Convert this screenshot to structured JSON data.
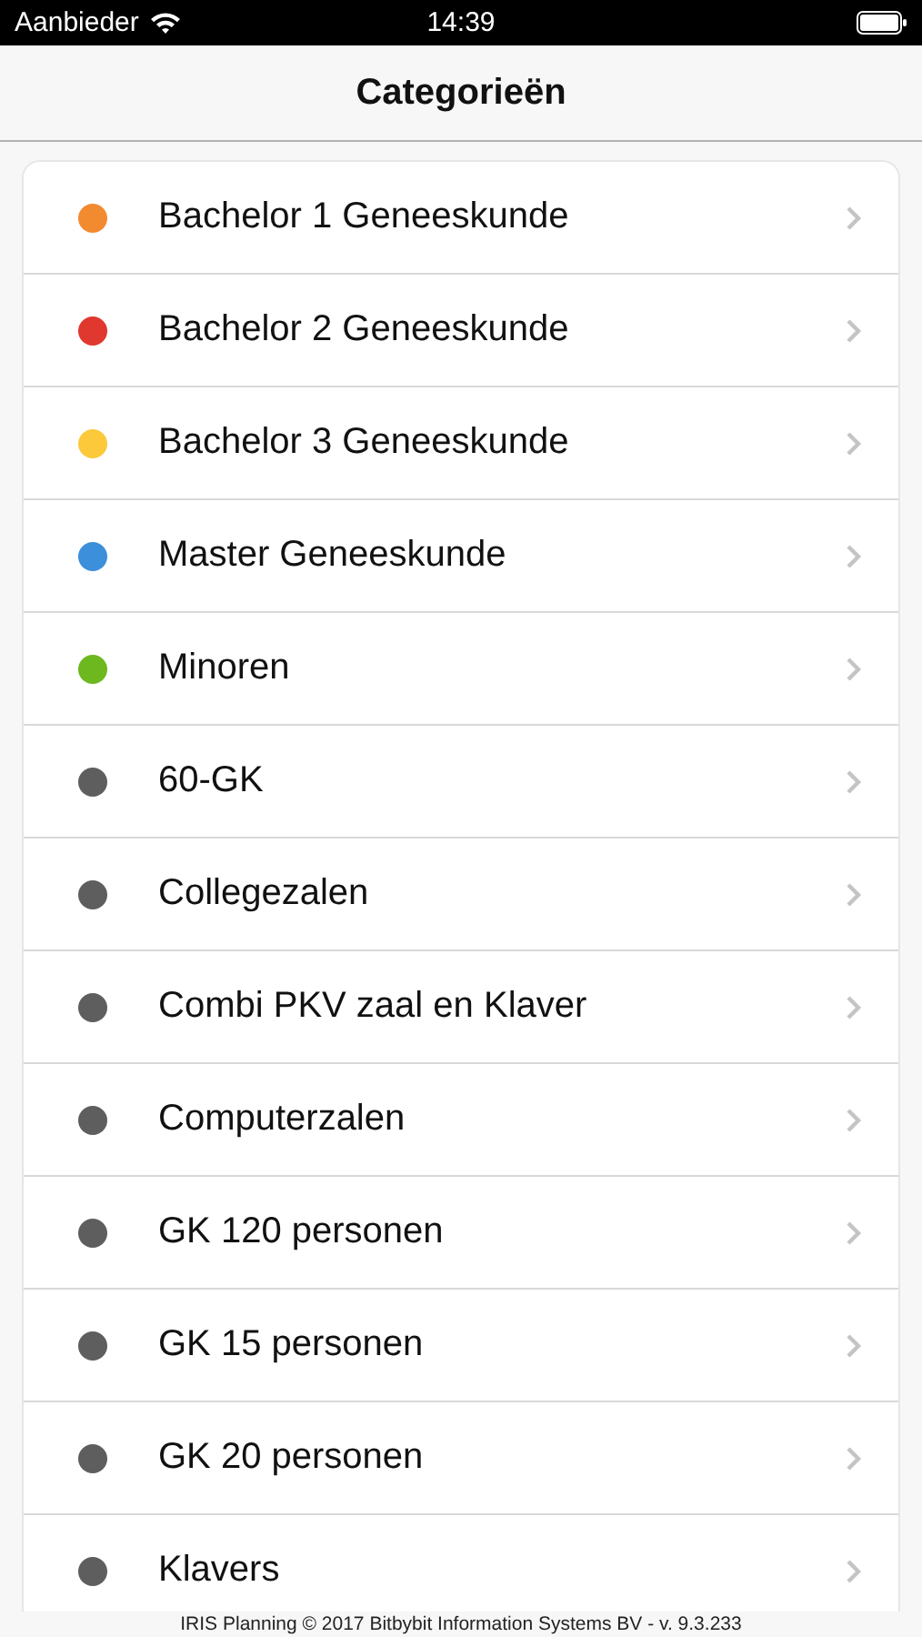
{
  "status_bar": {
    "carrier": "Aanbieder",
    "time": "14:39"
  },
  "nav_bar": {
    "title": "Categorieën"
  },
  "categories": [
    {
      "name": "Bachelor 1 Geneeskunde",
      "color": "#f28a30"
    },
    {
      "name": "Bachelor 2 Geneeskunde",
      "color": "#e0382e"
    },
    {
      "name": "Bachelor 3 Geneeskunde",
      "color": "#fbc93a"
    },
    {
      "name": "Master Geneeskunde",
      "color": "#3b8fdb"
    },
    {
      "name": "Minoren",
      "color": "#6cb81e"
    },
    {
      "name": "60-GK",
      "color": "#5e5e5e"
    },
    {
      "name": "Collegezalen",
      "color": "#5e5e5e"
    },
    {
      "name": "Combi PKV zaal en Klaver",
      "color": "#5e5e5e"
    },
    {
      "name": "Computerzalen",
      "color": "#5e5e5e"
    },
    {
      "name": "GK 120 personen",
      "color": "#5e5e5e"
    },
    {
      "name": "GK 15 personen",
      "color": "#5e5e5e"
    },
    {
      "name": "GK 20 personen",
      "color": "#5e5e5e"
    },
    {
      "name": "Klavers",
      "color": "#5e5e5e"
    }
  ],
  "footer": "IRIS Planning © 2017 Bitbybit Information Systems BV - v. 9.3.233"
}
